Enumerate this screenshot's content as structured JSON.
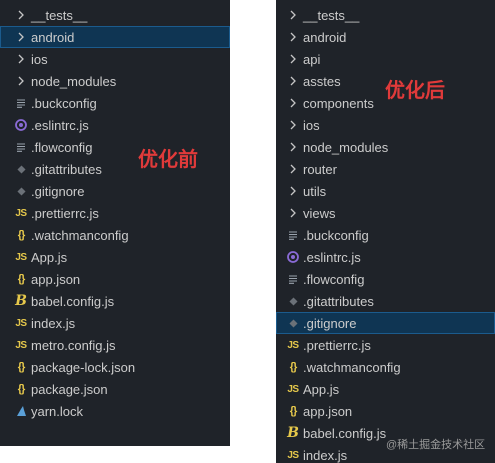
{
  "left_panel": {
    "annotation": "优化前",
    "items": [
      {
        "label": "__tests__",
        "icon": "chevron-right-icon"
      },
      {
        "label": "android",
        "icon": "chevron-right-icon",
        "selected": true
      },
      {
        "label": "ios",
        "icon": "chevron-right-icon"
      },
      {
        "label": "node_modules",
        "icon": "chevron-right-icon"
      },
      {
        "label": ".buckconfig",
        "icon": "lines-icon"
      },
      {
        "label": ".eslintrc.js",
        "icon": "eslint-icon"
      },
      {
        "label": ".flowconfig",
        "icon": "lines-icon"
      },
      {
        "label": ".gitattributes",
        "icon": "diamond-icon"
      },
      {
        "label": ".gitignore",
        "icon": "diamond-icon"
      },
      {
        "label": ".prettierrc.js",
        "icon": "js-icon"
      },
      {
        "label": ".watchmanconfig",
        "icon": "braces-icon"
      },
      {
        "label": "App.js",
        "icon": "js-icon"
      },
      {
        "label": "app.json",
        "icon": "braces-icon"
      },
      {
        "label": "babel.config.js",
        "icon": "babel-icon"
      },
      {
        "label": "index.js",
        "icon": "js-icon"
      },
      {
        "label": "metro.config.js",
        "icon": "js-icon"
      },
      {
        "label": "package-lock.json",
        "icon": "braces-icon"
      },
      {
        "label": "package.json",
        "icon": "braces-icon"
      },
      {
        "label": "yarn.lock",
        "icon": "yarn-icon"
      }
    ]
  },
  "right_panel": {
    "annotation": "优化后",
    "items": [
      {
        "label": "__tests__",
        "icon": "chevron-right-icon"
      },
      {
        "label": "android",
        "icon": "chevron-right-icon"
      },
      {
        "label": "api",
        "icon": "chevron-right-icon"
      },
      {
        "label": "asstes",
        "icon": "chevron-right-icon"
      },
      {
        "label": "components",
        "icon": "chevron-right-icon"
      },
      {
        "label": "ios",
        "icon": "chevron-right-icon"
      },
      {
        "label": "node_modules",
        "icon": "chevron-right-icon"
      },
      {
        "label": "router",
        "icon": "chevron-right-icon"
      },
      {
        "label": "utils",
        "icon": "chevron-right-icon"
      },
      {
        "label": "views",
        "icon": "chevron-right-icon"
      },
      {
        "label": ".buckconfig",
        "icon": "lines-icon"
      },
      {
        "label": ".eslintrc.js",
        "icon": "eslint-icon"
      },
      {
        "label": ".flowconfig",
        "icon": "lines-icon"
      },
      {
        "label": ".gitattributes",
        "icon": "diamond-icon"
      },
      {
        "label": ".gitignore",
        "icon": "diamond-icon",
        "selected": true
      },
      {
        "label": ".prettierrc.js",
        "icon": "js-icon"
      },
      {
        "label": ".watchmanconfig",
        "icon": "braces-icon"
      },
      {
        "label": "App.js",
        "icon": "js-icon"
      },
      {
        "label": "app.json",
        "icon": "braces-icon"
      },
      {
        "label": "babel.config.js",
        "icon": "babel-icon"
      },
      {
        "label": "index.js",
        "icon": "js-icon"
      }
    ]
  },
  "watermark": "@稀土掘金技术社区",
  "colors": {
    "panel_bg": "#1f2329",
    "selected_bg": "#0f3553",
    "text": "#cccccc",
    "annotation": "#e03a3a",
    "js_yellow": "#e6c84b",
    "eslint_purple": "#8a6bd6"
  }
}
